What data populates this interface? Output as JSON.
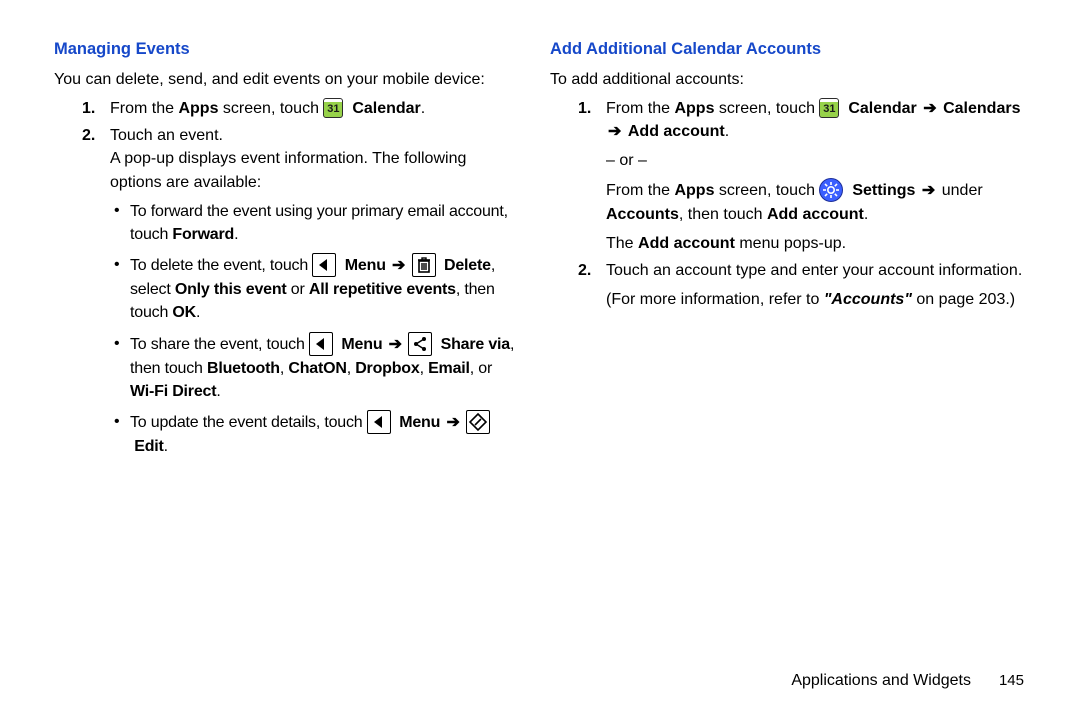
{
  "left": {
    "heading": "Managing Events",
    "intro": "You can delete, send, and edit events on your mobile device:",
    "step1_pre": "From the ",
    "step1_apps": "Apps",
    "step1_mid": " screen, touch ",
    "step1_calendar": "Calendar",
    "step1_end": ".",
    "step2_line": "Touch an event.",
    "step2_para": "A pop-up displays event information. The following options are available:",
    "b1_pre": "To forward the event using your primary email account, touch ",
    "b1_fwd": "Forward",
    "b1_end": ".",
    "b2_pre": "To delete the event, touch ",
    "b2_menu": "Menu",
    "b2_delete": "Delete",
    "b2_mid": ", select ",
    "b2_only": "Only this event",
    "b2_or": " or ",
    "b2_all": "All repetitive events",
    "b2_then": ", then touch ",
    "b2_ok": "OK",
    "b2_end": ".",
    "b3_pre": "To share the event, touch ",
    "b3_menu": "Menu",
    "b3_share": "Share via",
    "b3_mid": ", then touch ",
    "b3_bt": "Bluetooth",
    "b3_c1": ", ",
    "b3_chaton": "ChatON",
    "b3_c2": ", ",
    "b3_dropbox": "Dropbox",
    "b3_c3": ", ",
    "b3_email": "Email",
    "b3_or": ", or ",
    "b3_wifi": "Wi-Fi Direct",
    "b3_end": ".",
    "b4_pre": "To update the event details, touch ",
    "b4_menu": "Menu",
    "b4_edit": "Edit",
    "b4_end": "."
  },
  "right": {
    "heading": "Add Additional Calendar Accounts",
    "intro": "To add additional accounts:",
    "s1_pre": "From the ",
    "s1_apps": "Apps",
    "s1_mid": " screen, touch ",
    "s1_calendar": "Calendar",
    "s1_calendars": "Calendars",
    "s1_add": "Add account",
    "s1_end": ".",
    "or": "– or –",
    "alt_pre": "From the ",
    "alt_apps": "Apps",
    "alt_mid": " screen, touch ",
    "alt_settings": "Settings",
    "alt_under": " under ",
    "alt_accounts": "Accounts",
    "alt_then": ", then touch ",
    "alt_add": "Add account",
    "alt_end": ".",
    "popline_pre": "The ",
    "popline_b": "Add account",
    "popline_post": " menu pops-up.",
    "s2": "Touch an account type and enter your account information.",
    "ref_pre": "(For more information, refer to ",
    "ref_link": "\"Accounts\"",
    "ref_post": " on page 203.)"
  },
  "icons": {
    "cal_day": "31"
  },
  "footer": {
    "section": "Applications and Widgets",
    "page": "145"
  }
}
